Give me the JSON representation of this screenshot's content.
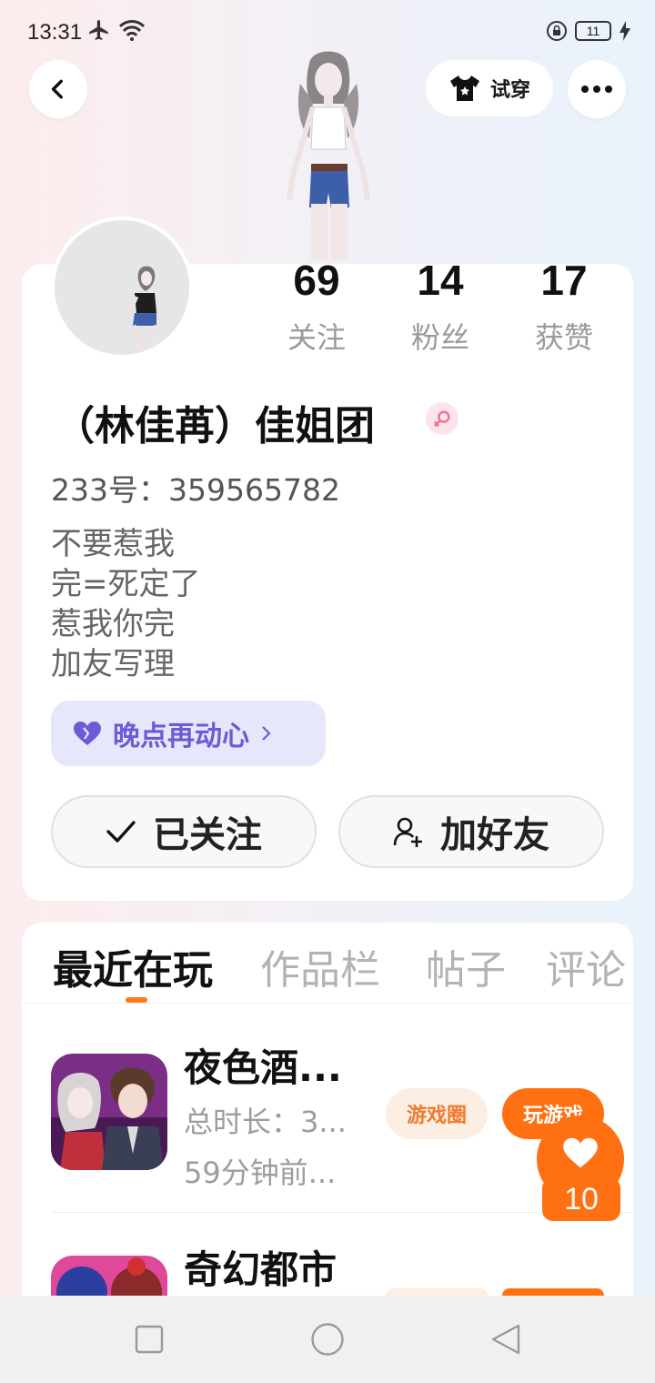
{
  "status_bar": {
    "time": "13:31",
    "battery": "11"
  },
  "header": {
    "try_on_label": "试穿"
  },
  "profile": {
    "stats": [
      {
        "value": "69",
        "label": "关注"
      },
      {
        "value": "14",
        "label": "粉丝"
      },
      {
        "value": "17",
        "label": "获赞"
      }
    ],
    "name": "（林佳苒）佳姐团",
    "uid": "233号：359565782",
    "bio": [
      "不要惹我",
      "完=死定了",
      "惹我你完",
      "加友写理"
    ],
    "mood": "晚点再动心",
    "follow_button": "已关注",
    "add_friend_button": "加好友"
  },
  "tabs": [
    "最近在玩",
    "作品栏",
    "帖子",
    "评论"
  ],
  "games": [
    {
      "title": "夜色酒...",
      "duration": "总时长：3...",
      "last_played": "59分钟前...",
      "circle": "游戏圈",
      "play": "玩游戏"
    },
    {
      "title": "奇幻都市"
    }
  ],
  "like": {
    "count": "10"
  },
  "colors": {
    "accent": "#ff7012",
    "mood": "#6b5bd6",
    "mood_bg": "#e7e7fb"
  }
}
